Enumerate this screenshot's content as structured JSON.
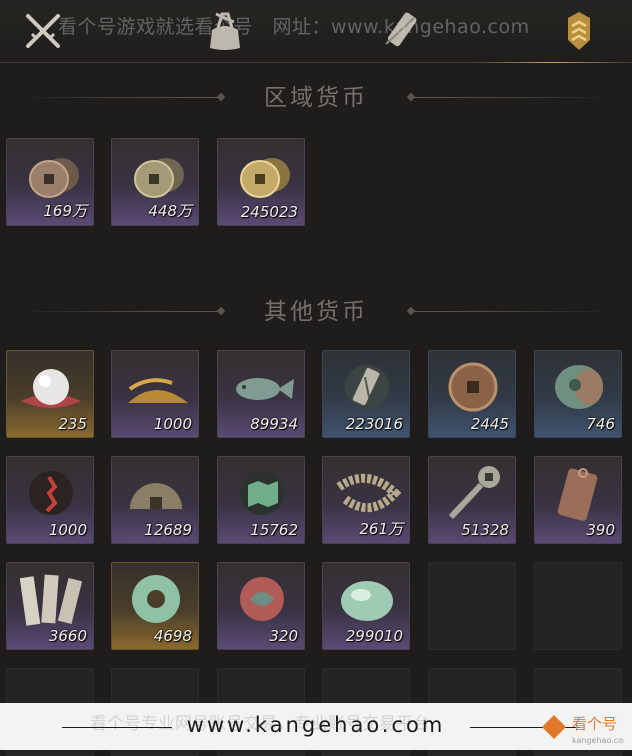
{
  "watermark": {
    "top_text": "看个号游戏就选看个号　网址：www.kangehao.com",
    "bottom_url": "www.kangehao.com",
    "bottom_faint": "看个号专业网号账号交易，专业账号交易平台",
    "brand": "看个号",
    "brand_sub": "kangehao.com"
  },
  "tabs": [
    {
      "name": "crossed-swords-icon"
    },
    {
      "name": "bag-icon"
    },
    {
      "name": "scroll-icon"
    },
    {
      "name": "rank-badge-icon",
      "active": true
    }
  ],
  "colors": {
    "accent_gold": "#c9a35a",
    "rarity_purple": "#5a4a74",
    "rarity_blue": "#3f5470",
    "rarity_gold": "#8a6a2e"
  },
  "sections": {
    "regional": {
      "title": "区域货币",
      "items": [
        {
          "icon": "copper-coins-icon",
          "qty": "169万",
          "rarity": "purple"
        },
        {
          "icon": "bronze-coins-icon",
          "qty": "448万",
          "rarity": "purple"
        },
        {
          "icon": "gold-coins-icon",
          "qty": "245023",
          "rarity": "purple"
        }
      ]
    },
    "other": {
      "title": "其他货币",
      "items": [
        {
          "icon": "pearl-icon",
          "qty": "235",
          "rarity": "gold"
        },
        {
          "icon": "grain-pile-icon",
          "qty": "1000",
          "rarity": "purple"
        },
        {
          "icon": "jade-fish-icon",
          "qty": "89934",
          "rarity": "purple"
        },
        {
          "icon": "token-tablet-icon",
          "qty": "223016",
          "rarity": "blue"
        },
        {
          "icon": "ancient-coin-icon",
          "qty": "2445",
          "rarity": "blue"
        },
        {
          "icon": "jade-stone-icon",
          "qty": "746",
          "rarity": "blue"
        },
        {
          "icon": "red-sigil-icon",
          "qty": "1000",
          "rarity": "purple"
        },
        {
          "icon": "half-coin-icon",
          "qty": "12689",
          "rarity": "purple"
        },
        {
          "icon": "green-map-icon",
          "qty": "15762",
          "rarity": "purple"
        },
        {
          "icon": "coin-string-icon",
          "qty": "261万",
          "rarity": "purple"
        },
        {
          "icon": "key-coin-icon",
          "qty": "51328",
          "rarity": "purple"
        },
        {
          "icon": "bronze-plaque-icon",
          "qty": "390",
          "rarity": "purple"
        },
        {
          "icon": "bamboo-slips-icon",
          "qty": "3660",
          "rarity": "purple"
        },
        {
          "icon": "jade-disc-icon",
          "qty": "4698",
          "rarity": "gold"
        },
        {
          "icon": "red-jade-icon",
          "qty": "320",
          "rarity": "purple"
        },
        {
          "icon": "jade-pebble-icon",
          "qty": "299010",
          "rarity": "purple"
        }
      ]
    }
  }
}
